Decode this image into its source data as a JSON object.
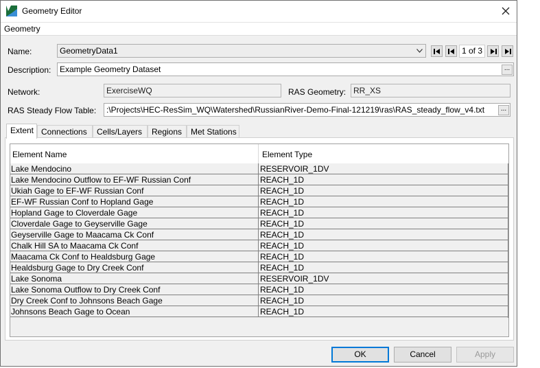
{
  "window": {
    "title": "Geometry Editor",
    "icon": "hec-ressim-app-icon",
    "close_icon": "close-icon"
  },
  "menu": {
    "items": [
      {
        "label": "Geometry"
      }
    ]
  },
  "form": {
    "name_label": "Name:",
    "name_value": "GeometryData1",
    "page_indicator": "1 of 3",
    "description_label": "Description:",
    "description_value": "Example Geometry Dataset",
    "network_label": "Network:",
    "network_value": "ExerciseWQ",
    "ras_geometry_label": "RAS Geometry:",
    "ras_geometry_value": "RR_XS",
    "ras_steady_label": "RAS Steady Flow Table:",
    "ras_steady_value": ":\\Projects\\HEC-ResSim_WQ\\Watershed\\RussianRiver-Demo-Final-121219\\ras\\RAS_steady_flow_v4.txt",
    "browse_label": "..."
  },
  "tabs": [
    {
      "label": "Extent",
      "active": true
    },
    {
      "label": "Connections",
      "active": false
    },
    {
      "label": "Cells/Layers",
      "active": false
    },
    {
      "label": "Regions",
      "active": false
    },
    {
      "label": "Met Stations",
      "active": false
    }
  ],
  "table": {
    "columns": [
      "Element Name",
      "Element Type"
    ],
    "rows": [
      [
        "Lake Mendocino",
        "RESERVOIR_1DV"
      ],
      [
        "Lake Mendocino Outflow to EF-WF Russian Conf",
        "REACH_1D"
      ],
      [
        "Ukiah Gage to EF-WF Russian Conf",
        "REACH_1D"
      ],
      [
        "EF-WF Russian Conf to Hopland Gage",
        "REACH_1D"
      ],
      [
        "Hopland Gage to Cloverdale Gage",
        "REACH_1D"
      ],
      [
        "Cloverdale Gage to Geyserville Gage",
        "REACH_1D"
      ],
      [
        "Geyserville Gage to Maacama Ck Conf",
        "REACH_1D"
      ],
      [
        "Chalk Hill SA to Maacama Ck Conf",
        "REACH_1D"
      ],
      [
        "Maacama Ck Conf to Healdsburg Gage",
        "REACH_1D"
      ],
      [
        "Healdsburg Gage to Dry Creek Conf",
        "REACH_1D"
      ],
      [
        "Lake Sonoma",
        "RESERVOIR_1DV"
      ],
      [
        "Lake Sonoma Outflow to Dry Creek Conf",
        "REACH_1D"
      ],
      [
        "Dry Creek Conf to Johnsons Beach Gage",
        "REACH_1D"
      ],
      [
        "Johnsons Beach Gage to Ocean",
        "REACH_1D"
      ]
    ]
  },
  "buttons": {
    "ok": "OK",
    "cancel": "Cancel",
    "apply": "Apply"
  },
  "colors": {
    "default_button_border": "#0078d7",
    "window_bg": "#f0f0f0"
  }
}
